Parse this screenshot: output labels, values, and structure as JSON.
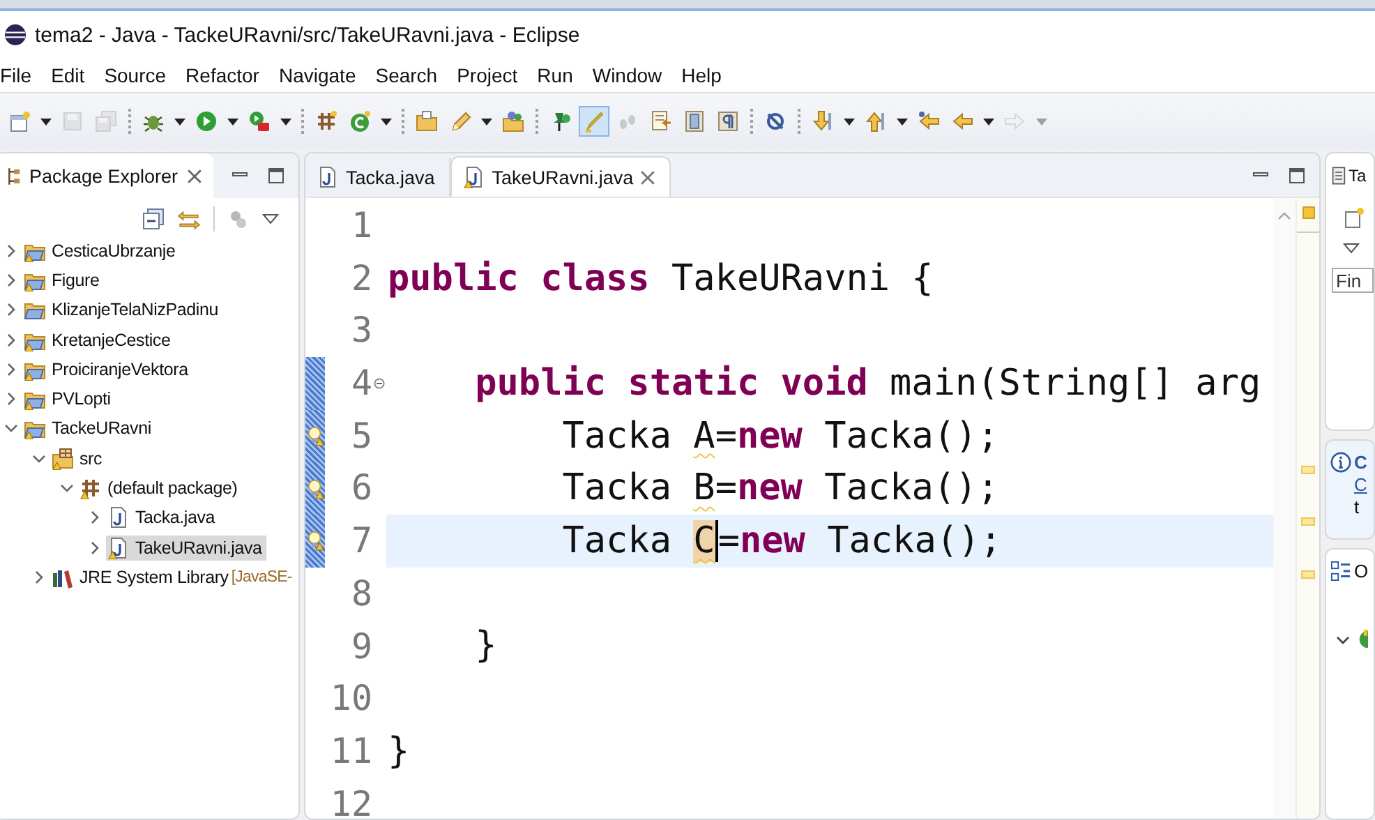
{
  "window": {
    "title": "tema2 - Java - TackeURavni/src/TakeURavni.java - Eclipse"
  },
  "menu": [
    "File",
    "Edit",
    "Source",
    "Refactor",
    "Navigate",
    "Search",
    "Project",
    "Run",
    "Window",
    "Help"
  ],
  "toolbar": [
    {
      "kind": "button",
      "disabled": false,
      "pressed": false,
      "dropdown": true
    },
    {
      "kind": "button",
      "disabled": true,
      "pressed": false,
      "dropdown": false
    },
    {
      "kind": "button",
      "disabled": true,
      "pressed": false,
      "dropdown": false
    },
    {
      "kind": "separator"
    },
    {
      "kind": "button",
      "disabled": false,
      "pressed": false,
      "dropdown": true
    },
    {
      "kind": "button",
      "disabled": false,
      "pressed": false,
      "dropdown": true
    },
    {
      "kind": "button",
      "disabled": false,
      "pressed": false,
      "dropdown": true
    },
    {
      "kind": "separator"
    },
    {
      "kind": "button",
      "disabled": false,
      "pressed": false,
      "dropdown": false
    },
    {
      "kind": "button",
      "disabled": false,
      "pressed": false,
      "dropdown": true
    },
    {
      "kind": "separator"
    },
    {
      "kind": "button",
      "disabled": false,
      "pressed": false,
      "dropdown": false
    },
    {
      "kind": "button",
      "disabled": false,
      "pressed": false,
      "dropdown": true
    },
    {
      "kind": "button",
      "disabled": false,
      "pressed": false,
      "dropdown": false
    },
    {
      "kind": "separator"
    },
    {
      "kind": "button",
      "disabled": false,
      "pressed": false,
      "dropdown": false
    },
    {
      "kind": "button",
      "disabled": false,
      "pressed": true,
      "dropdown": false
    },
    {
      "kind": "button",
      "disabled": true,
      "pressed": false,
      "dropdown": false
    },
    {
      "kind": "button",
      "disabled": false,
      "pressed": false,
      "dropdown": false
    },
    {
      "kind": "button",
      "disabled": false,
      "pressed": false,
      "dropdown": false
    },
    {
      "kind": "button",
      "disabled": false,
      "pressed": false,
      "dropdown": false
    },
    {
      "kind": "separator"
    },
    {
      "kind": "button",
      "disabled": false,
      "pressed": false,
      "dropdown": false
    },
    {
      "kind": "separator"
    },
    {
      "kind": "button",
      "disabled": false,
      "pressed": false,
      "dropdown": true
    },
    {
      "kind": "button",
      "disabled": false,
      "pressed": false,
      "dropdown": true
    },
    {
      "kind": "button",
      "disabled": false,
      "pressed": false,
      "dropdown": false
    },
    {
      "kind": "button",
      "disabled": false,
      "pressed": false,
      "dropdown": true
    },
    {
      "kind": "button",
      "disabled": true,
      "pressed": false,
      "dropdown": true
    }
  ],
  "package_explorer": {
    "title": "Package Explorer",
    "items": [
      {
        "label": "CesticaUbrzanje",
        "kind": "project",
        "warning": true,
        "expanded": false,
        "selected": false
      },
      {
        "label": "Figure",
        "kind": "project",
        "warning": true,
        "expanded": false,
        "selected": false
      },
      {
        "label": "KlizanjeTelaNizPadinu",
        "kind": "project",
        "warning": false,
        "expanded": false,
        "selected": false
      },
      {
        "label": "KretanjeCestice",
        "kind": "project",
        "warning": true,
        "expanded": false,
        "selected": false
      },
      {
        "label": "ProiciranjeVektora",
        "kind": "project",
        "warning": true,
        "expanded": false,
        "selected": false
      },
      {
        "label": "PVLopti",
        "kind": "project",
        "warning": true,
        "expanded": false,
        "selected": false
      },
      {
        "label": "TackeURavni",
        "kind": "project",
        "warning": true,
        "expanded": true,
        "selected": false,
        "children": [
          {
            "label": "src",
            "kind": "source-folder",
            "warning": true,
            "expanded": true,
            "selected": false,
            "children": [
              {
                "label": "(default package)",
                "kind": "package",
                "warning": true,
                "expanded": true,
                "selected": false,
                "children": [
                  {
                    "label": "Tacka.java",
                    "kind": "java-file",
                    "warning": false,
                    "expanded": false,
                    "selected": false
                  },
                  {
                    "label": "TakeURavni.java",
                    "kind": "java-file",
                    "warning": true,
                    "expanded": false,
                    "selected": true
                  }
                ]
              }
            ]
          },
          {
            "label": "JRE System Library",
            "decoration": "[JavaSE-",
            "kind": "library",
            "warning": false,
            "expanded": false,
            "selected": false
          }
        ]
      }
    ]
  },
  "editor": {
    "tabs": [
      {
        "label": "Tacka.java",
        "selected": false,
        "warning": false
      },
      {
        "label": "TakeURavni.java",
        "selected": true,
        "warning": true
      }
    ],
    "lines": [
      {
        "number": "1",
        "current": false,
        "changed": false,
        "warning": false,
        "fold": false
      },
      {
        "number": "2",
        "current": false,
        "changed": false,
        "warning": false,
        "fold": false,
        "tokens": [
          {
            "text": "public class",
            "kind": "keyword"
          },
          {
            "text": " TakeURavni {",
            "kind": "plain"
          }
        ]
      },
      {
        "number": "3",
        "current": false,
        "changed": false,
        "warning": false,
        "fold": false
      },
      {
        "number": "4",
        "current": false,
        "changed": true,
        "warning": false,
        "fold": true,
        "tokens": [
          {
            "text": "    public static void",
            "kind": "keyword"
          },
          {
            "text": " main(String[] arg",
            "kind": "plain"
          }
        ]
      },
      {
        "number": "5",
        "current": false,
        "changed": true,
        "warning": true,
        "fold": false,
        "tokens": [
          {
            "text": "        Tacka ",
            "kind": "plain"
          },
          {
            "text": "A",
            "kind": "warning"
          },
          {
            "text": "=",
            "kind": "plain"
          },
          {
            "text": "new",
            "kind": "keyword"
          },
          {
            "text": " Tacka();",
            "kind": "plain"
          }
        ]
      },
      {
        "number": "6",
        "current": false,
        "changed": true,
        "warning": true,
        "fold": false,
        "tokens": [
          {
            "text": "        Tacka ",
            "kind": "plain"
          },
          {
            "text": "B",
            "kind": "warning"
          },
          {
            "text": "=",
            "kind": "plain"
          },
          {
            "text": "new",
            "kind": "keyword"
          },
          {
            "text": " Tacka();",
            "kind": "plain"
          }
        ]
      },
      {
        "number": "7",
        "current": true,
        "changed": true,
        "warning": true,
        "fold": false,
        "tokens": [
          {
            "text": "        Tacka ",
            "kind": "plain"
          },
          {
            "text": "C",
            "kind": "occurrence"
          },
          {
            "text": "=",
            "kind": "plain"
          },
          {
            "text": "new",
            "kind": "keyword"
          },
          {
            "text": " Tacka();",
            "kind": "plain"
          }
        ]
      },
      {
        "number": "8",
        "current": false,
        "changed": false,
        "warning": false,
        "fold": false
      },
      {
        "number": "9",
        "current": false,
        "changed": false,
        "warning": false,
        "fold": false,
        "tokens": [
          {
            "text": "    }",
            "kind": "plain"
          }
        ]
      },
      {
        "number": "10",
        "current": false,
        "changed": false,
        "warning": false,
        "fold": false
      },
      {
        "number": "11",
        "current": false,
        "changed": false,
        "warning": false,
        "fold": false,
        "tokens": [
          {
            "text": "}",
            "kind": "plain"
          }
        ]
      },
      {
        "number": "12",
        "current": false,
        "changed": false,
        "warning": false,
        "fold": false
      }
    ]
  },
  "right_panel": {
    "tab": "Ta",
    "find_placeholder": "Fin",
    "info_title": "C",
    "info_link": "C",
    "info_text": "t",
    "outline_title": "O"
  }
}
